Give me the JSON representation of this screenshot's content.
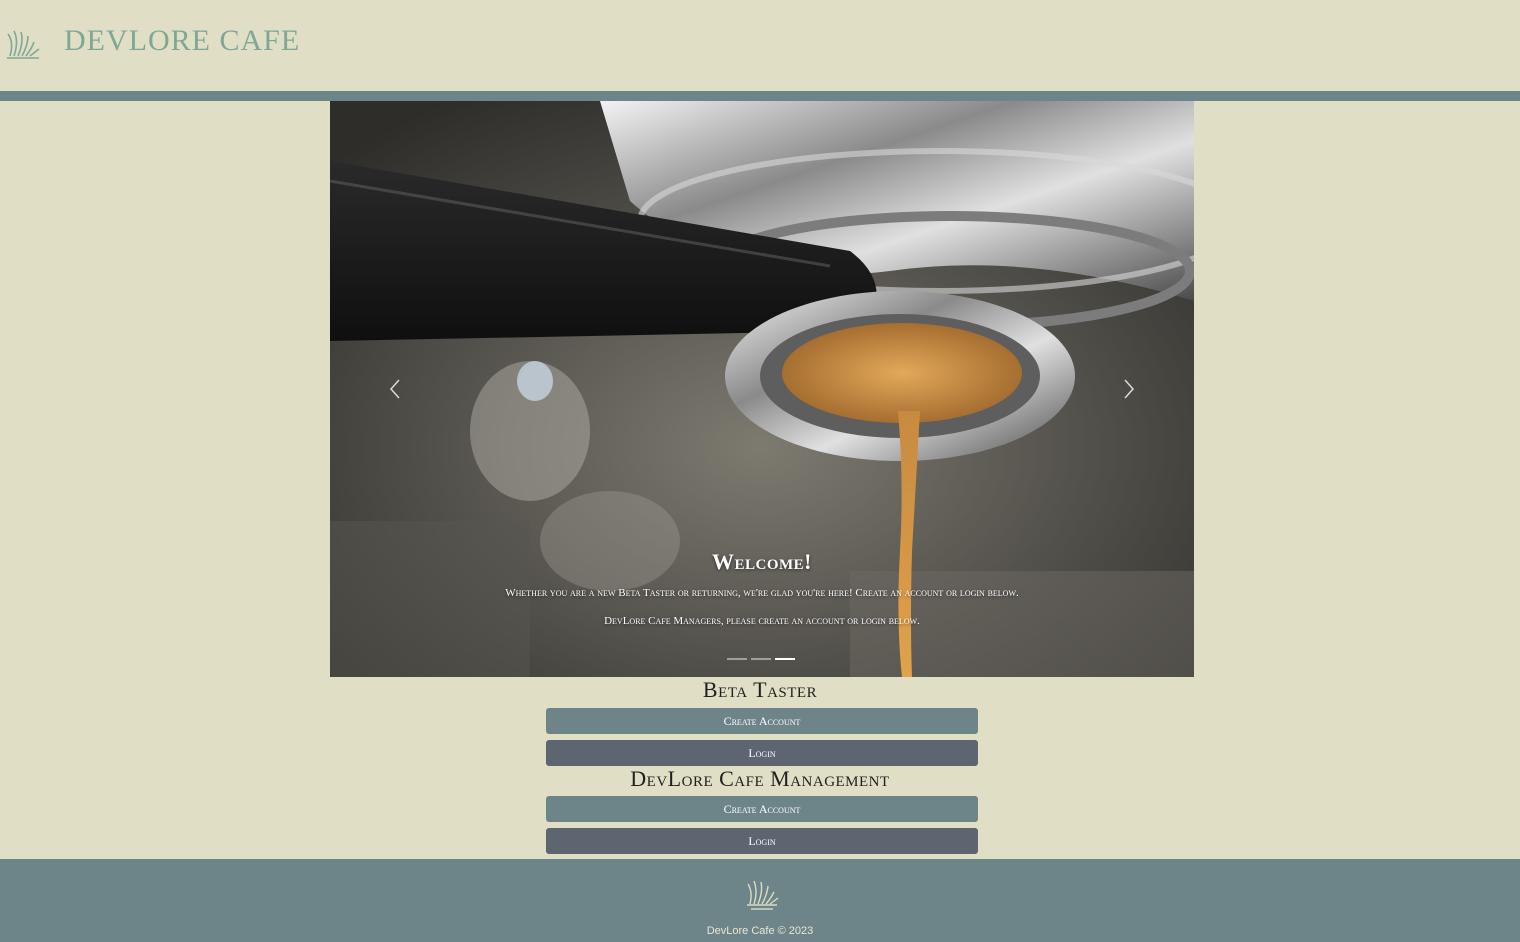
{
  "header": {
    "brand": "DevLore Cafe",
    "logo_icon": "devlore-leaf-logo"
  },
  "carousel": {
    "image": "espresso-machine-pouring-shot",
    "prev_icon": "chevron-left-icon",
    "next_icon": "chevron-right-icon",
    "slide_title": "Welcome!",
    "slide_text_1": "Whether you are a new Beta Taster or returning, we're glad you're here! Create an account or login below.",
    "slide_text_2": "DevLore Cafe Managers, please create an account or login below.",
    "indicator_count": 3,
    "active_indicator": 3
  },
  "beta_taster": {
    "title": "Beta Taster",
    "create_label": "Create Account",
    "login_label": "Login"
  },
  "management": {
    "title": "DevLore Cafe Management",
    "create_label": "Create Account",
    "login_label": "Login"
  },
  "footer": {
    "logo_icon": "devlore-leaf-logo",
    "copyright": "DevLore Cafe © 2023"
  },
  "colors": {
    "background": "#e0dfc5",
    "accent": "#6d8589",
    "login_button": "#5d6570",
    "brand_text": "#7fa796"
  }
}
